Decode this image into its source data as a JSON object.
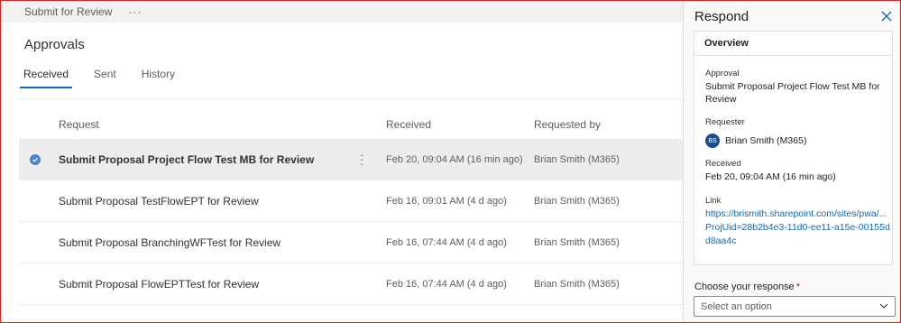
{
  "topbar": {
    "title": "Submit for Review",
    "more": "···"
  },
  "main": {
    "title": "Approvals",
    "tabs": [
      "Received",
      "Sent",
      "History"
    ],
    "columns": {
      "request": "Request",
      "received": "Received",
      "requested_by": "Requested by"
    },
    "rows": [
      {
        "request": "Submit Proposal Project Flow Test MB for Review",
        "received": "Feb 20, 09:04 AM (16 min ago)",
        "requested_by": "Brian Smith (M365)"
      },
      {
        "request": "Submit Proposal TestFlowEPT for Review",
        "received": "Feb 16, 09:01 AM (4 d ago)",
        "requested_by": "Brian Smith (M365)"
      },
      {
        "request": "Submit Proposal BranchingWFTest for Review",
        "received": "Feb 16, 07:44 AM (4 d ago)",
        "requested_by": "Brian Smith (M365)"
      },
      {
        "request": "Submit Proposal FlowEPTTest for Review",
        "received": "Feb 16, 07:44 AM (4 d ago)",
        "requested_by": "Brian Smith (M365)"
      }
    ]
  },
  "panel": {
    "title": "Respond",
    "overview": "Overview",
    "approval_label": "Approval",
    "approval_value": "Submit Proposal Project Flow Test MB for Review",
    "requester_label": "Requester",
    "requester_initials": "BS",
    "requester_name": "Brian Smith (M365)",
    "received_label": "Received",
    "received_value": "Feb 20, 09:04 AM (16 min ago)",
    "link_label": "Link",
    "link_value": "https://brismith.sharepoint.com/sites/pwa/...ProjUid=28b2b4e3-11d0-ee11-a15e-00155dd8aa4c",
    "response_label": "Choose your response",
    "required_marker": "*",
    "response_placeholder": "Select an option"
  },
  "colors": {
    "accent": "#0f6cbd",
    "border": "#e02020",
    "avatar": "#1b4f8a",
    "required": "#c50f1f"
  }
}
